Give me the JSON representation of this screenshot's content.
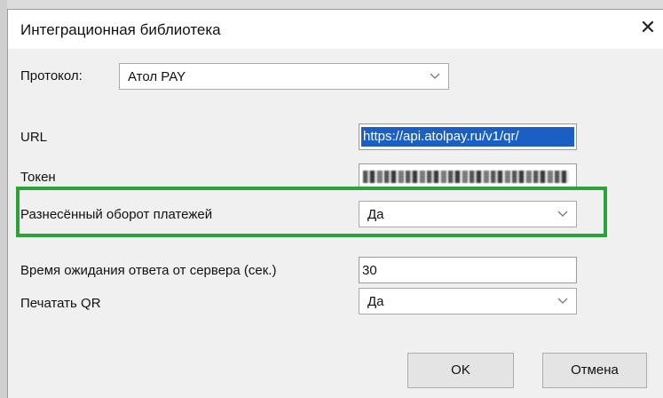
{
  "window": {
    "title": "Интеграционная библиотека",
    "close_glyph": "✕"
  },
  "form": {
    "protocol_label": "Протокол:",
    "protocol_value": "Атол PAY",
    "url_label": "URL",
    "url_value": "https://api.atolpay.ru/v1/qr/",
    "token_label": "Токен",
    "split_label": "Разнесённый оборот платежей",
    "split_value": "Да",
    "timeout_label": "Время ожидания ответа от сервера (сек.)",
    "timeout_value": "30",
    "print_qr_label": "Печатать QR",
    "print_qr_value": "Да"
  },
  "buttons": {
    "ok": "OK",
    "cancel": "Отмена"
  },
  "colors": {
    "highlight": "#2aa33a",
    "selection": "#1c5fc4"
  }
}
